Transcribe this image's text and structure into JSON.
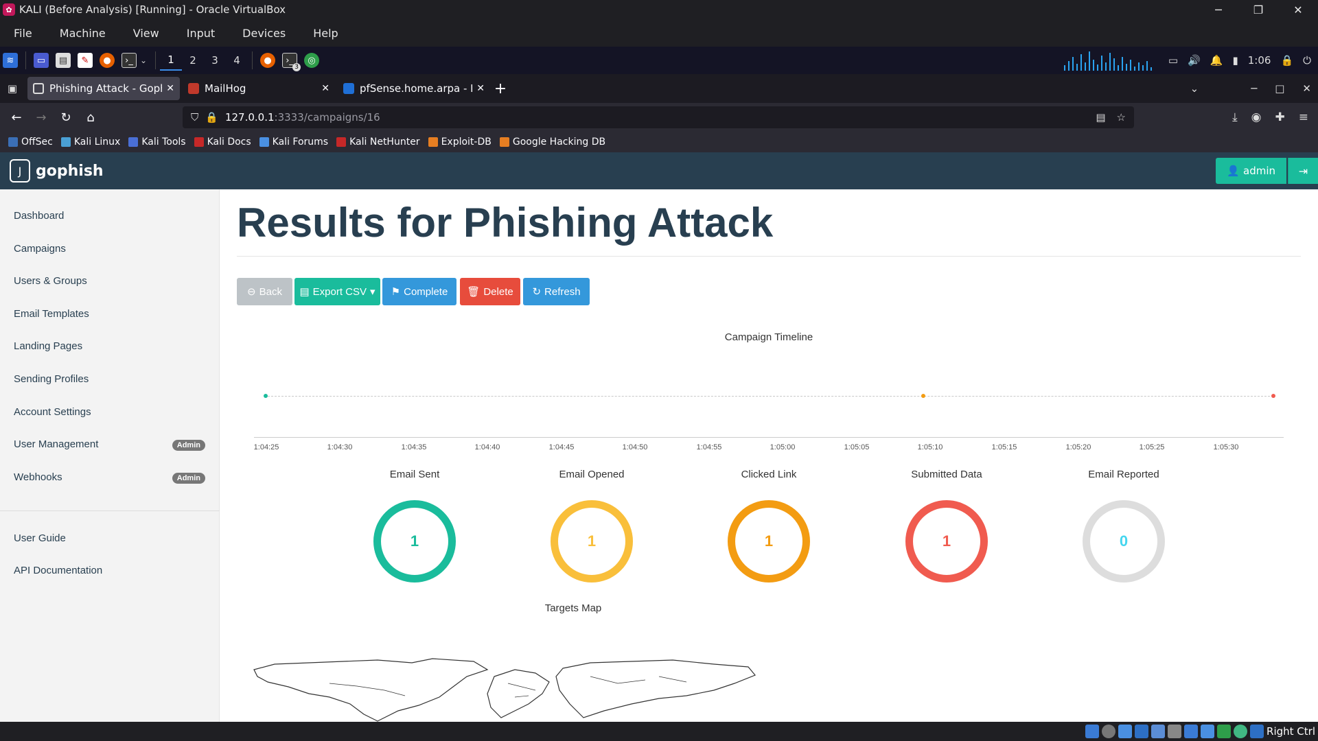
{
  "window": {
    "title": "KALI (Before Analysis) [Running] - Oracle VirtualBox"
  },
  "vbox_menu": [
    "File",
    "Machine",
    "View",
    "Input",
    "Devices",
    "Help"
  ],
  "kali_panel": {
    "workspaces": [
      "1",
      "2",
      "3",
      "4"
    ],
    "clock": "1:06",
    "terminal_count": "3"
  },
  "tabs": [
    {
      "title": "Phishing Attack - Gophish",
      "color": "#5a5a66"
    },
    {
      "title": "MailHog",
      "color": "#c0392b"
    },
    {
      "title": "pfSense.home.arpa - Fire",
      "color": "#1f6fd6"
    }
  ],
  "url": {
    "host": "127.0.0.1",
    "path": ":3333/campaigns/16"
  },
  "bookmarks": [
    {
      "label": "OffSec",
      "color": "#3b6fb6"
    },
    {
      "label": "Kali Linux",
      "color": "#4aa0d5"
    },
    {
      "label": "Kali Tools",
      "color": "#4a6fd5"
    },
    {
      "label": "Kali Docs",
      "color": "#c62828"
    },
    {
      "label": "Kali Forums",
      "color": "#4a90e2"
    },
    {
      "label": "Kali NetHunter",
      "color": "#c62828"
    },
    {
      "label": "Exploit-DB",
      "color": "#e67e22"
    },
    {
      "label": "Google Hacking DB",
      "color": "#e67e22"
    }
  ],
  "gophish": {
    "brand": "gophish",
    "user": "admin",
    "sidebar": [
      {
        "label": "Dashboard",
        "badge": ""
      },
      {
        "label": "Campaigns",
        "badge": ""
      },
      {
        "label": "Users & Groups",
        "badge": ""
      },
      {
        "label": "Email Templates",
        "badge": ""
      },
      {
        "label": "Landing Pages",
        "badge": ""
      },
      {
        "label": "Sending Profiles",
        "badge": ""
      },
      {
        "label": "Account Settings",
        "badge": ""
      },
      {
        "label": "User Management",
        "badge": "Admin"
      },
      {
        "label": "Webhooks",
        "badge": "Admin"
      }
    ],
    "sidebar_bottom": [
      "User Guide",
      "API Documentation"
    ],
    "title": "Results for Phishing Attack",
    "buttons": {
      "back": "Back",
      "export": "Export CSV",
      "complete": "Complete",
      "delete": "Delete",
      "refresh": "Refresh"
    },
    "timeline": {
      "title": "Campaign Timeline",
      "ticks": [
        "1:04:25",
        "1:04:30",
        "1:04:35",
        "1:04:40",
        "1:04:45",
        "1:04:50",
        "1:04:55",
        "1:05:00",
        "1:05:05",
        "1:05:10",
        "1:05:15",
        "1:05:20",
        "1:05:25",
        "1:05:30"
      ]
    },
    "stats": [
      {
        "label": "Email Sent",
        "value": "1",
        "color": "#1abc9c"
      },
      {
        "label": "Email Opened",
        "value": "1",
        "color": "#f9bf3b"
      },
      {
        "label": "Clicked Link",
        "value": "1",
        "color": "#f39c12"
      },
      {
        "label": "Submitted Data",
        "value": "1",
        "color": "#f05b4f"
      },
      {
        "label": "Email Reported",
        "value": "0",
        "color": "#dddddd"
      }
    ],
    "email_reported_value_color": "#45d6ef",
    "map_title": "Targets Map"
  },
  "status_bar": {
    "host_key": "Right Ctrl"
  }
}
